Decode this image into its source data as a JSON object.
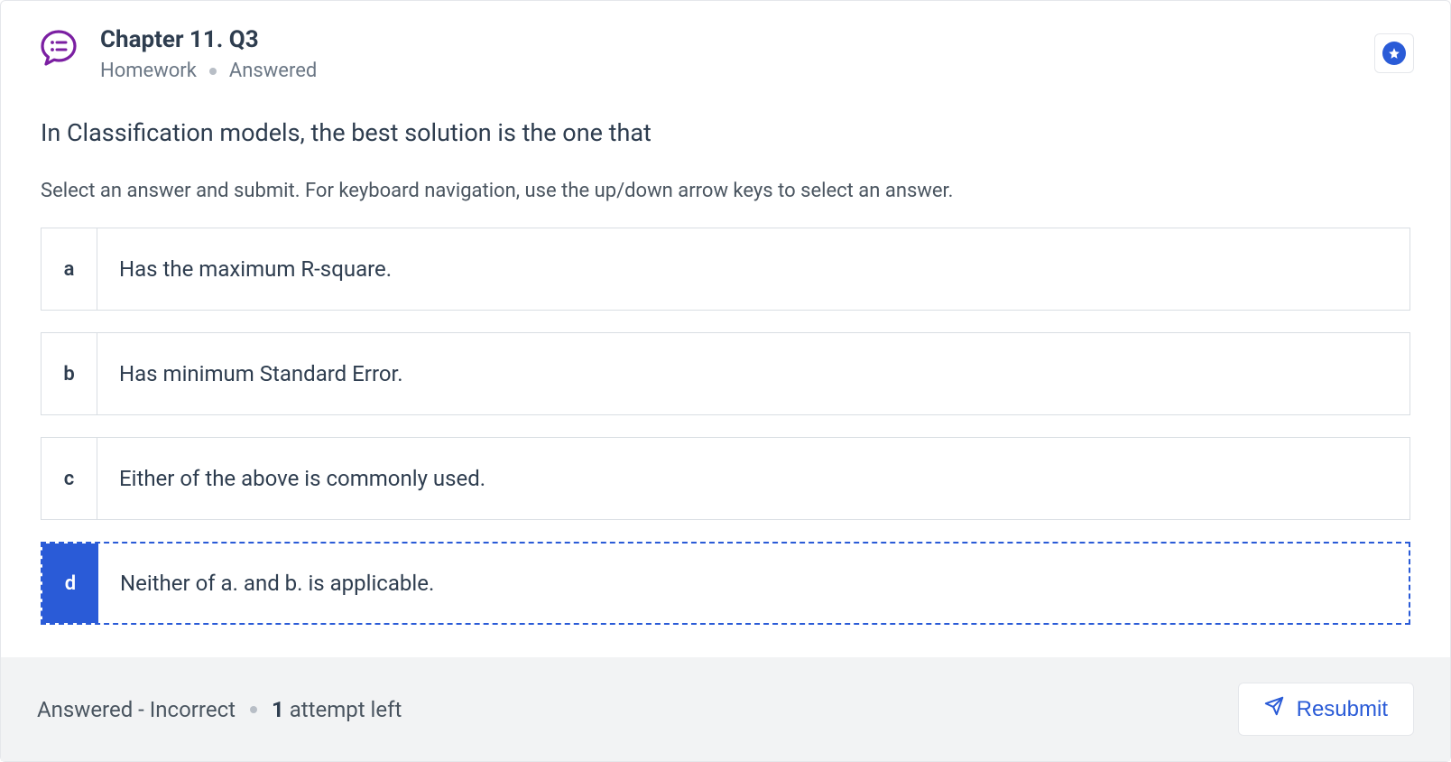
{
  "header": {
    "title": "Chapter 11. Q3",
    "type_label": "Homework",
    "status_label": "Answered"
  },
  "question": "In Classification models, the best solution is the one that",
  "instructions": "Select an answer and submit. For keyboard navigation, use the up/down arrow keys to select an answer.",
  "options": [
    {
      "letter": "a",
      "text": "Has the maximum R-square.",
      "selected": false
    },
    {
      "letter": "b",
      "text": "Has minimum Standard Error.",
      "selected": false
    },
    {
      "letter": "c",
      "text": "Either of the above is commonly used.",
      "selected": false
    },
    {
      "letter": "d",
      "text": "Neither of a. and b. is applicable.",
      "selected": true
    }
  ],
  "footer": {
    "status_prefix": "Answered - Incorrect",
    "attempts_number": "1",
    "attempts_suffix": " attempt left",
    "resubmit_label": "Resubmit"
  }
}
